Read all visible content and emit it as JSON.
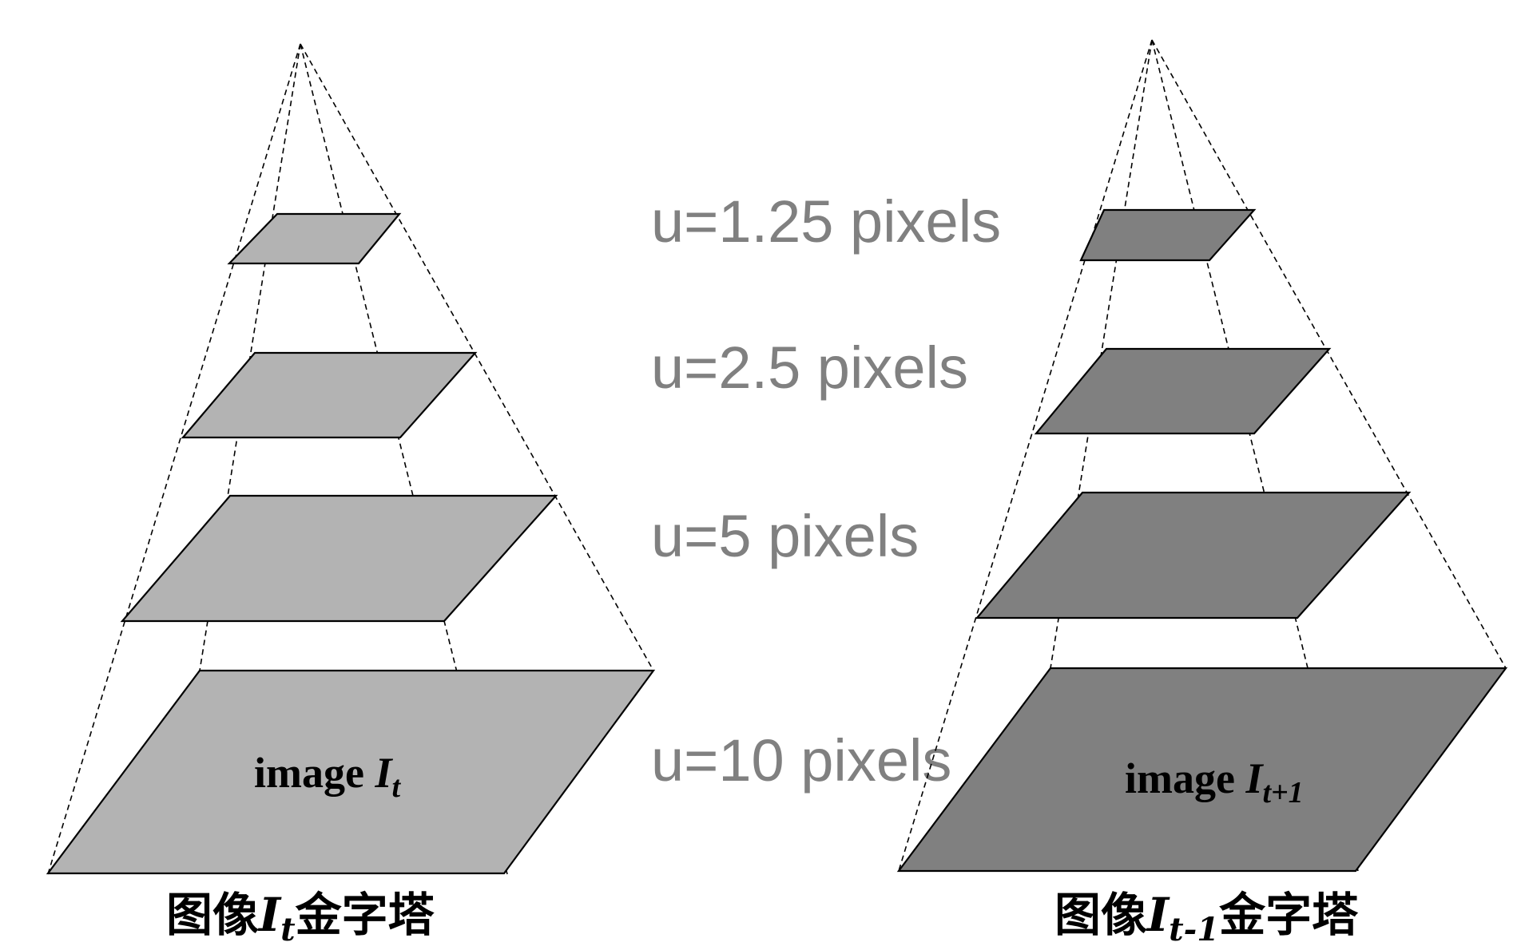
{
  "left_pyramid": {
    "image_label": {
      "prefix": "image ",
      "symbol": "I",
      "subscript": "t"
    },
    "caption": {
      "prefix": "图像",
      "symbol": "I",
      "subscript": "t",
      "suffix": "金字塔"
    },
    "fill_color": "#b3b3b3"
  },
  "right_pyramid": {
    "image_label": {
      "prefix": "image ",
      "symbol": "I",
      "subscript": "t+1"
    },
    "caption": {
      "prefix": "图像",
      "symbol": "I",
      "subscript": "t-1",
      "suffix": "金字塔"
    },
    "fill_color": "#808080"
  },
  "levels": [
    {
      "label": "u=1.25 pixels"
    },
    {
      "label": "u=2.5 pixels"
    },
    {
      "label": "u=5 pixels"
    },
    {
      "label": "u=10 pixels"
    }
  ],
  "colors": {
    "level_label": "#808080",
    "guide_line": "#000000"
  }
}
